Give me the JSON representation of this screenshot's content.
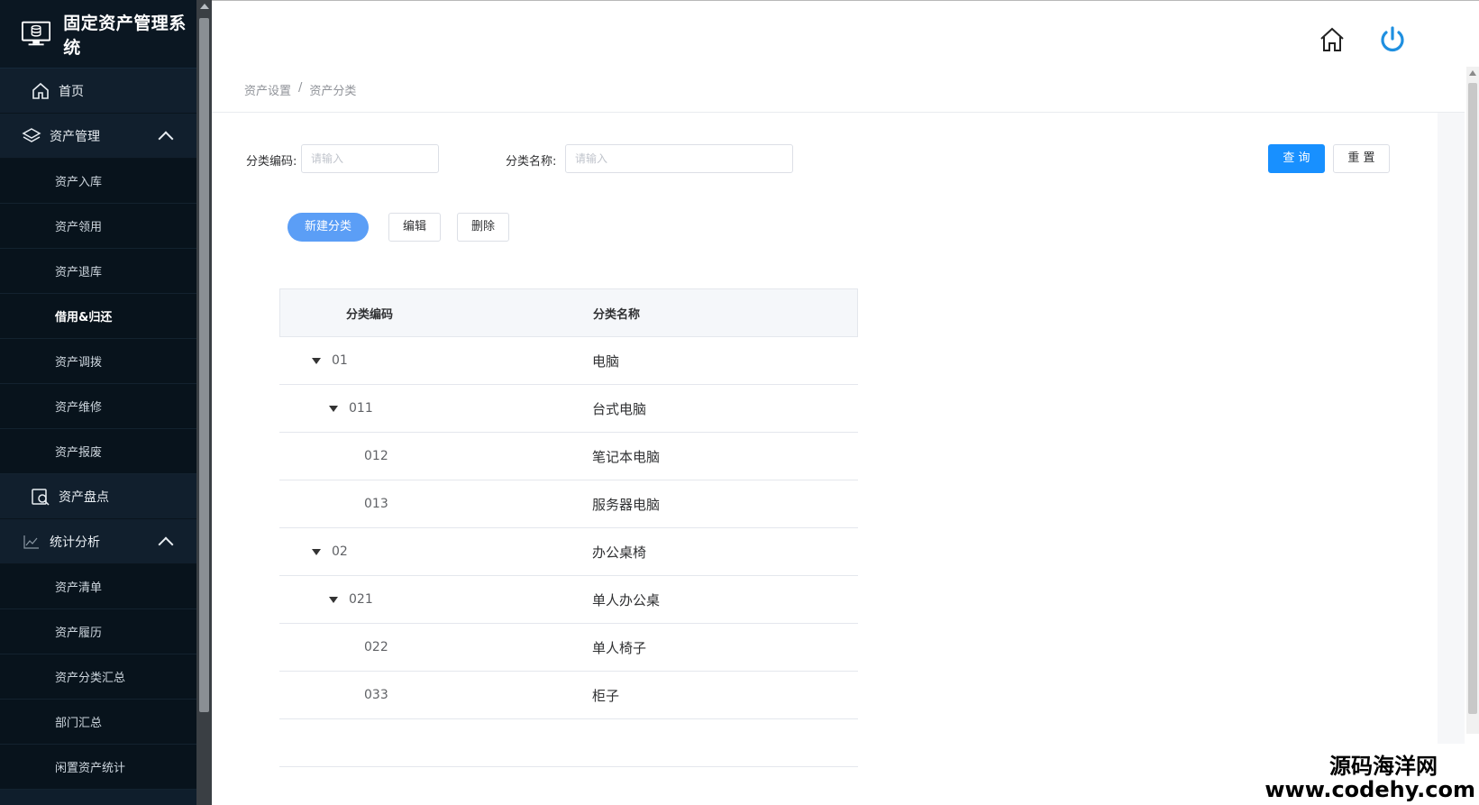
{
  "app": {
    "title": "固定资产管理系统"
  },
  "sidebar": {
    "home": "首页",
    "asset_mgmt": {
      "label": "资产管理",
      "items": [
        "资产入库",
        "资产领用",
        "资产退库",
        "借用&归还",
        "资产调拨",
        "资产维修",
        "资产报废"
      ]
    },
    "inventory": "资产盘点",
    "stats": {
      "label": "统计分析",
      "items": [
        "资产清单",
        "资产履历",
        "资产分类汇总",
        "部门汇总",
        "闲置资产统计"
      ]
    }
  },
  "breadcrumb": {
    "first": "资产设置",
    "sep": "/",
    "second": "资产分类"
  },
  "search": {
    "code_label": "分类编码:",
    "code_placeholder": "请输入",
    "name_label": "分类名称:",
    "name_placeholder": "请输入",
    "query": "查 询",
    "reset": "重 置"
  },
  "actions": {
    "new": "新建分类",
    "edit": "编辑",
    "delete": "删除"
  },
  "table": {
    "headers": [
      "分类编码",
      "分类名称"
    ],
    "rows": [
      {
        "code": "01",
        "name": "电脑"
      },
      {
        "code": "011",
        "name": "台式电脑"
      },
      {
        "code": "012",
        "name": "笔记本电脑"
      },
      {
        "code": "013",
        "name": "服务器电脑"
      },
      {
        "code": "02",
        "name": "办公桌椅"
      },
      {
        "code": "021",
        "name": "单人办公桌"
      },
      {
        "code": "022",
        "name": "单人椅子"
      },
      {
        "code": "033",
        "name": "柜子"
      }
    ]
  },
  "watermark": {
    "line1": "源码海洋网",
    "line2": "www.codehy.com"
  },
  "colors": {
    "sidebar": "#0f1e2c",
    "primary": "#1890ff",
    "power_icon": "#1e8fe0"
  }
}
